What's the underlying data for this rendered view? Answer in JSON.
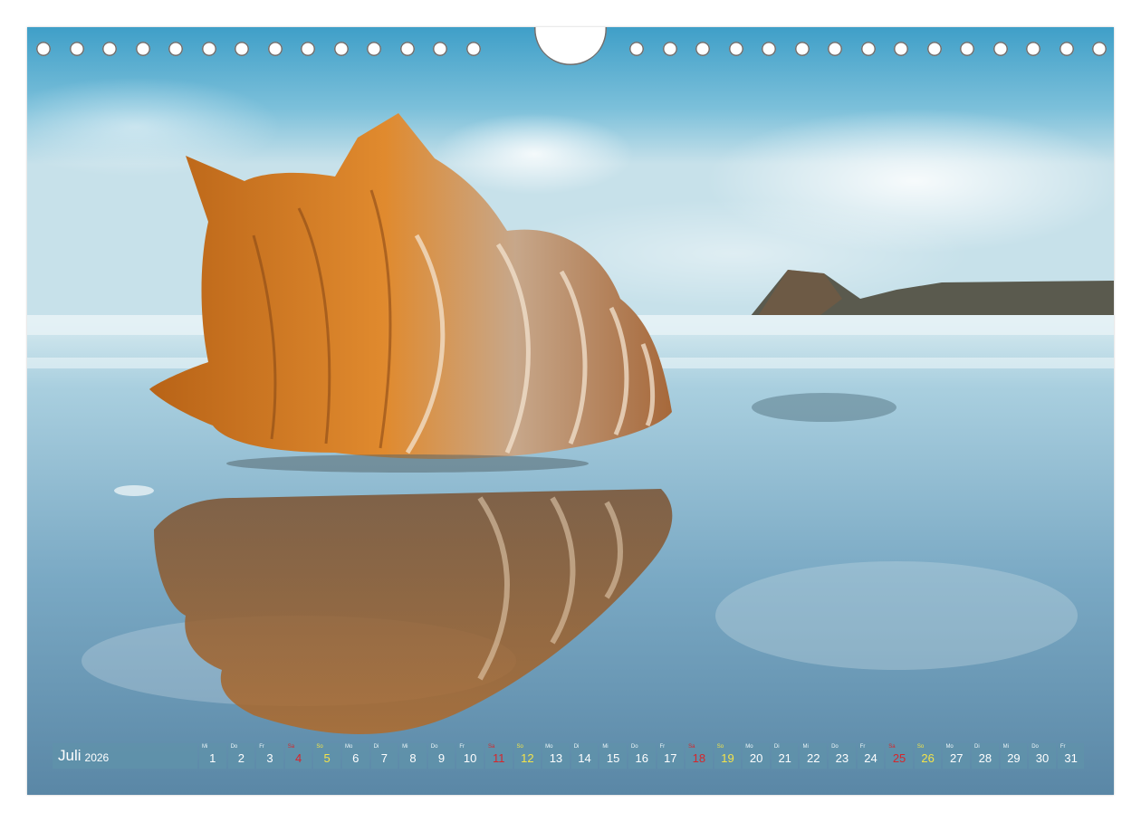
{
  "calendar": {
    "month": "Juli",
    "year": "2026",
    "days": [
      {
        "dow": "Mi",
        "num": "1",
        "kind": "weekday"
      },
      {
        "dow": "Do",
        "num": "2",
        "kind": "weekday"
      },
      {
        "dow": "Fr",
        "num": "3",
        "kind": "weekday"
      },
      {
        "dow": "Sa",
        "num": "4",
        "kind": "sun"
      },
      {
        "dow": "So",
        "num": "5",
        "kind": "sat"
      },
      {
        "dow": "Mo",
        "num": "6",
        "kind": "weekday"
      },
      {
        "dow": "Di",
        "num": "7",
        "kind": "weekday"
      },
      {
        "dow": "Mi",
        "num": "8",
        "kind": "weekday"
      },
      {
        "dow": "Do",
        "num": "9",
        "kind": "weekday"
      },
      {
        "dow": "Fr",
        "num": "10",
        "kind": "weekday"
      },
      {
        "dow": "Sa",
        "num": "11",
        "kind": "sun"
      },
      {
        "dow": "So",
        "num": "12",
        "kind": "sat"
      },
      {
        "dow": "Mo",
        "num": "13",
        "kind": "weekday"
      },
      {
        "dow": "Di",
        "num": "14",
        "kind": "weekday"
      },
      {
        "dow": "Mi",
        "num": "15",
        "kind": "weekday"
      },
      {
        "dow": "Do",
        "num": "16",
        "kind": "weekday"
      },
      {
        "dow": "Fr",
        "num": "17",
        "kind": "weekday"
      },
      {
        "dow": "Sa",
        "num": "18",
        "kind": "sun"
      },
      {
        "dow": "So",
        "num": "19",
        "kind": "sat"
      },
      {
        "dow": "Mo",
        "num": "20",
        "kind": "weekday"
      },
      {
        "dow": "Di",
        "num": "21",
        "kind": "weekday"
      },
      {
        "dow": "Mi",
        "num": "22",
        "kind": "weekday"
      },
      {
        "dow": "Do",
        "num": "23",
        "kind": "weekday"
      },
      {
        "dow": "Fr",
        "num": "24",
        "kind": "weekday"
      },
      {
        "dow": "Sa",
        "num": "25",
        "kind": "sun"
      },
      {
        "dow": "So",
        "num": "26",
        "kind": "sat"
      },
      {
        "dow": "Mo",
        "num": "27",
        "kind": "weekday"
      },
      {
        "dow": "Di",
        "num": "28",
        "kind": "weekday"
      },
      {
        "dow": "Mi",
        "num": "29",
        "kind": "weekday"
      },
      {
        "dow": "Do",
        "num": "30",
        "kind": "weekday"
      },
      {
        "dow": "Fr",
        "num": "31",
        "kind": "weekday"
      }
    ]
  },
  "colors": {
    "bar": "#6092aa",
    "saturday_text": "#f3e34a",
    "sunday_text": "#d6262b",
    "sky": "#5fb0d2",
    "shell_orange": "#d9761e"
  },
  "icons": [
    "binding-hole-icon",
    "hanger-notch-icon"
  ]
}
